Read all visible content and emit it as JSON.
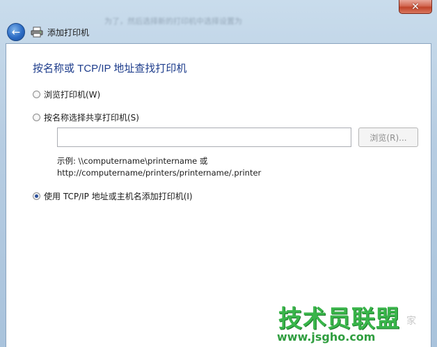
{
  "window": {
    "blurred_title": "为了，然后选择新的打印机中选择设置为",
    "close_symbol": "✕"
  },
  "header": {
    "back_icon": "back-arrow-icon",
    "title": "添加打印机"
  },
  "main": {
    "page_title": "按名称或 TCP/IP 地址查找打印机",
    "options": [
      {
        "label": "浏览打印机(W)",
        "selected": false
      },
      {
        "label": "按名称选择共享打印机(S)",
        "selected": false
      },
      {
        "label": "使用 TCP/IP 地址或主机名添加打印机(I)",
        "selected": true
      }
    ],
    "share_name_value": "",
    "browse_label": "浏览(R)...",
    "example_line1": "示例: \\\\computername\\printername 或",
    "example_line2": "http://computername/printers/printername/.printer"
  },
  "watermark": {
    "main": "技术员联盟",
    "url": "www.jsgho.com",
    "side": "家"
  },
  "colors": {
    "title_blue": "#1e3d8c",
    "watermark_green": "#39b54a",
    "close_red": "#c0442a"
  }
}
